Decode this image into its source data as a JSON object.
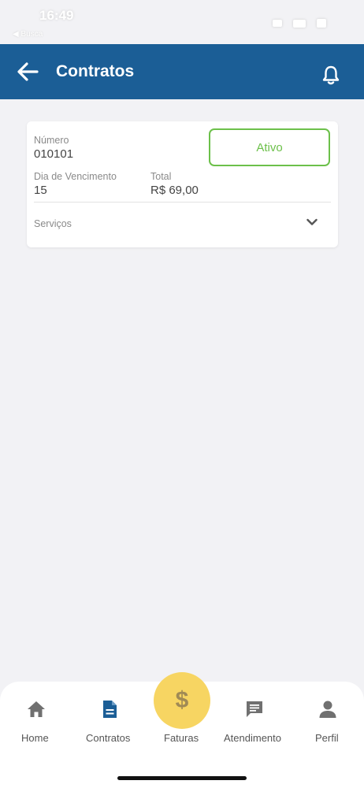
{
  "status_bar": {
    "time": "16:49",
    "back_app": "◀ Busca"
  },
  "header": {
    "title": "Contratos",
    "back_icon": "arrow-left-icon",
    "notification_icon": "bell-icon",
    "color": "#1b5e96"
  },
  "contract": {
    "number_label": "Número",
    "number": "010101",
    "status": "Ativo",
    "status_color": "#6cc04a",
    "due_day_label": "Dia de Vencimento",
    "due_day": "15",
    "total_label": "Total",
    "total": "R$ 69,00",
    "services_label": "Serviços",
    "services_icon": "chevron-down-icon"
  },
  "bottom_nav": {
    "active": "Contratos",
    "items": [
      {
        "label": "Home",
        "icon": "home-icon"
      },
      {
        "label": "Contratos",
        "icon": "document-icon"
      },
      {
        "label": "Faturas",
        "icon": "dollar-icon"
      },
      {
        "label": "Atendimento",
        "icon": "chat-icon"
      },
      {
        "label": "Perfil",
        "icon": "person-icon"
      }
    ],
    "fab_color": "#f7d562",
    "fab_symbol": "$"
  }
}
